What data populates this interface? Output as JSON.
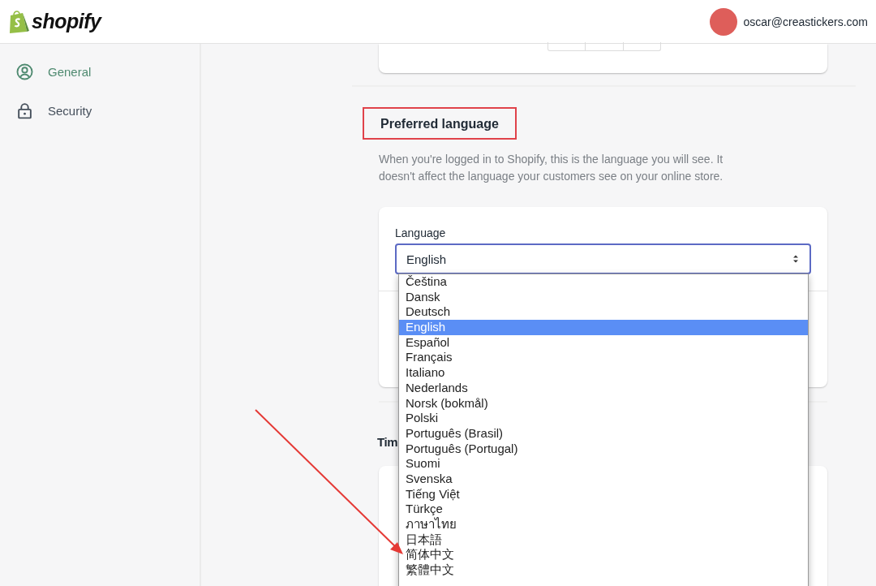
{
  "header": {
    "logo_text": "shopify",
    "account": "oscar@creastickers.com"
  },
  "sidebar": {
    "items": [
      {
        "label": "General",
        "kind": "person",
        "selected": true
      },
      {
        "label": "Security",
        "kind": "lock",
        "selected": false
      }
    ]
  },
  "preferred_language": {
    "title": "Preferred language",
    "highlighted": true,
    "description": "When you're logged in to Shopify, this is the language you will see. It doesn't affect the language your customers see on your online store.",
    "field": {
      "label": "Language",
      "value": "English",
      "focused": true
    }
  },
  "next_section": {
    "title": "Tim"
  },
  "dropdown": {
    "options": [
      {
        "label": "Čeština",
        "selected": false
      },
      {
        "label": "Dansk",
        "selected": false
      },
      {
        "label": "Deutsch",
        "selected": false
      },
      {
        "label": "English",
        "selected": true
      },
      {
        "label": "Español",
        "selected": false
      },
      {
        "label": "Français",
        "selected": false
      },
      {
        "label": "Italiano",
        "selected": false
      },
      {
        "label": "Nederlands",
        "selected": false
      },
      {
        "label": "Norsk (bokmål)",
        "selected": false
      },
      {
        "label": "Polski",
        "selected": false
      },
      {
        "label": "Português (Brasil)",
        "selected": false
      },
      {
        "label": "Português (Portugal)",
        "selected": false
      },
      {
        "label": "Suomi",
        "selected": false
      },
      {
        "label": "Svenska",
        "selected": false
      },
      {
        "label": "Tiếng Việt",
        "selected": false
      },
      {
        "label": "Türkçe",
        "selected": false
      },
      {
        "label": "ภาษาไทย",
        "selected": false
      },
      {
        "label": "日本語",
        "selected": false
      },
      {
        "label": "简体中文",
        "selected": false
      },
      {
        "label": "繁體中文",
        "selected": false
      }
    ]
  }
}
